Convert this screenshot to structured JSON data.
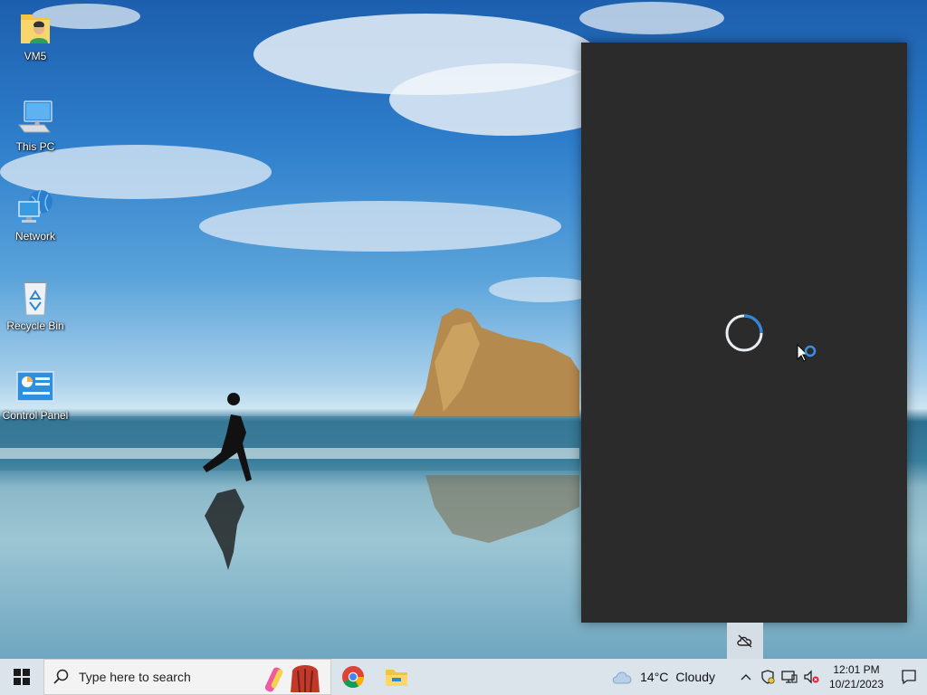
{
  "desktop": {
    "icons": [
      {
        "label": "VM5",
        "icon": "user-folder-icon"
      },
      {
        "label": "This PC",
        "icon": "computer-icon"
      },
      {
        "label": "Network",
        "icon": "network-icon"
      },
      {
        "label": "Recycle Bin",
        "icon": "recycle-bin-icon"
      },
      {
        "label": "Control Panel",
        "icon": "control-panel-icon"
      }
    ]
  },
  "flyout": {
    "state": "loading",
    "spinner_icon": "loading-spinner-icon",
    "cloud_icon": "onedrive-cloud-off-icon"
  },
  "taskbar": {
    "search_placeholder": "Type here to search",
    "pinned_apps": [
      "chrome-icon",
      "file-explorer-icon"
    ],
    "weather": {
      "temp": "14°C",
      "condition": "Cloudy",
      "icon": "cloud-icon"
    },
    "tray_icons": [
      "chevron-up-icon",
      "security-shield-icon",
      "network-monitor-icon",
      "volume-muted-icon"
    ],
    "clock": {
      "time": "12:01 PM",
      "date": "10/21/2023"
    }
  },
  "colors": {
    "taskbar_bg": "#dbe3eb",
    "flyout_bg": "#2b2b2b",
    "accent": "#0078d4"
  }
}
